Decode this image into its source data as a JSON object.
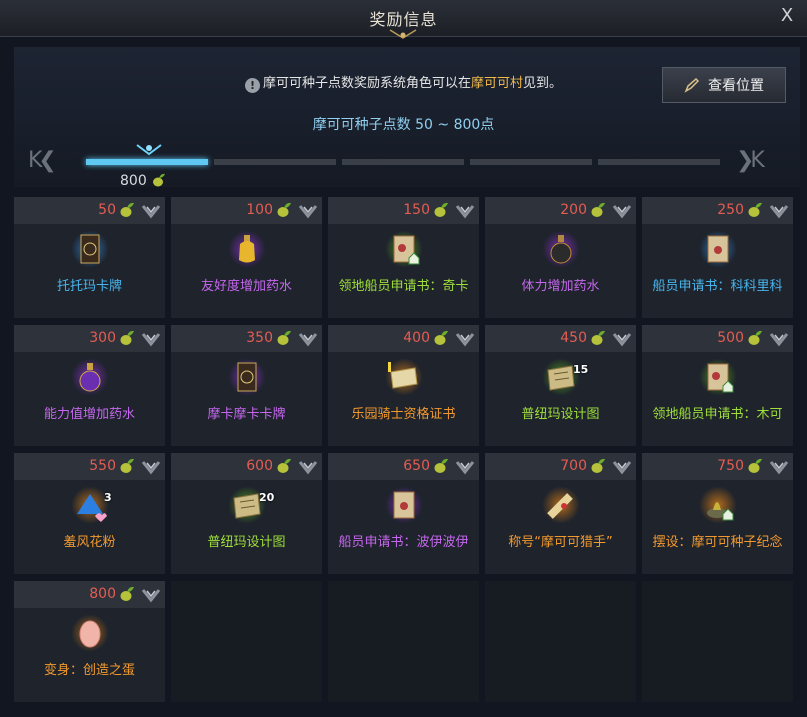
{
  "window": {
    "title": "奖励信息",
    "close_label": "X"
  },
  "info": {
    "prefix": "摩可可种子点数奖励系统角色可以在",
    "place": "摩可可村",
    "suffix": "见到。"
  },
  "view_button": {
    "label": "查看位置"
  },
  "range": {
    "label": "摩可可种子点数 50 ~ 800点"
  },
  "progress": {
    "current_value": "800",
    "segments": 5,
    "active_segment": 1
  },
  "nav": {
    "first": "K",
    "prev": "❮❮",
    "next": "❯❯",
    "last": "K"
  },
  "rewards": [
    {
      "points": "50",
      "name": "托托玛卡牌",
      "color": "blue",
      "icon": "card-icon"
    },
    {
      "points": "100",
      "name": "友好度增加药水",
      "color": "purple",
      "icon": "potion-icon"
    },
    {
      "points": "150",
      "name": "领地船员申请书：奇卡",
      "color": "green",
      "icon": "scroll-house-icon"
    },
    {
      "points": "200",
      "name": "体力增加药水",
      "color": "purple",
      "icon": "potion-dark-icon"
    },
    {
      "points": "250",
      "name": "船员申请书：科科里科",
      "color": "blue",
      "icon": "scroll-icon"
    },
    {
      "points": "300",
      "name": "能力值增加药水",
      "color": "purple",
      "icon": "potion-purple-icon"
    },
    {
      "points": "350",
      "name": "摩卡摩卡卡牌",
      "color": "purple",
      "icon": "card-icon"
    },
    {
      "points": "400",
      "name": "乐园骑士资格证书",
      "color": "orange",
      "icon": "certificate-icon"
    },
    {
      "points": "450",
      "name": "普纽玛设计图",
      "color": "green",
      "icon": "blueprint-icon",
      "count": "15"
    },
    {
      "points": "500",
      "name": "领地船员申请书：木可",
      "color": "green",
      "icon": "scroll-house-icon"
    },
    {
      "points": "550",
      "name": "羞风花粉",
      "color": "orange",
      "icon": "pollen-icon",
      "count": "3"
    },
    {
      "points": "600",
      "name": "普纽玛设计图",
      "color": "green",
      "icon": "blueprint-icon",
      "count": "20"
    },
    {
      "points": "650",
      "name": "船员申请书：波伊波伊",
      "color": "purple",
      "icon": "scroll-icon"
    },
    {
      "points": "700",
      "name": "称号“摩可可猎手”",
      "color": "orange",
      "icon": "title-scroll-icon"
    },
    {
      "points": "750",
      "name": "摆设：摩可可种子纪念",
      "color": "orange",
      "icon": "statue-icon"
    },
    {
      "points": "800",
      "name": "变身：创造之蛋",
      "color": "orange",
      "icon": "egg-icon"
    }
  ]
}
